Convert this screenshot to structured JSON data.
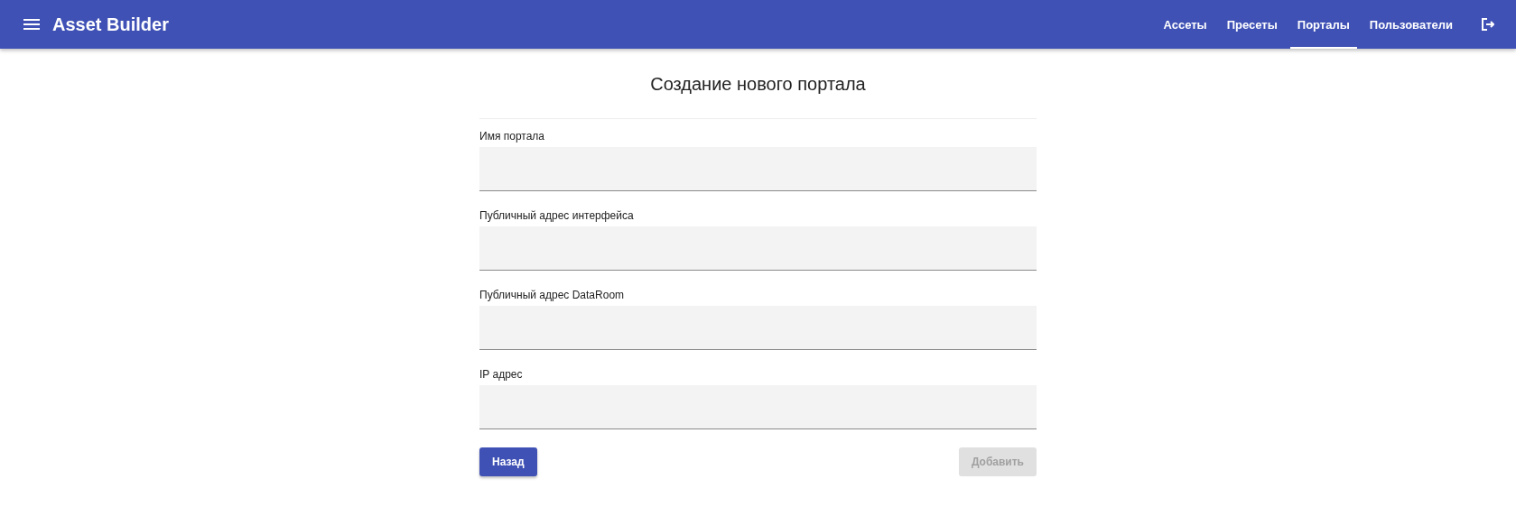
{
  "app_bar": {
    "title": "Asset Builder",
    "nav": [
      {
        "label": "Ассеты",
        "selected": false
      },
      {
        "label": "Пресеты",
        "selected": false
      },
      {
        "label": "Порталы",
        "selected": true
      },
      {
        "label": "Пользователи",
        "selected": false
      }
    ]
  },
  "form": {
    "title": "Создание нового портала",
    "fields": [
      {
        "label": "Имя портала"
      },
      {
        "label": "Публичный адрес интерфейса"
      },
      {
        "label": "Публичный адрес DataRoom"
      },
      {
        "label": "IP адрес"
      }
    ],
    "buttons": [
      {
        "label": "Назад",
        "disabled": false
      },
      {
        "label": "Добавить",
        "disabled": true
      }
    ]
  }
}
